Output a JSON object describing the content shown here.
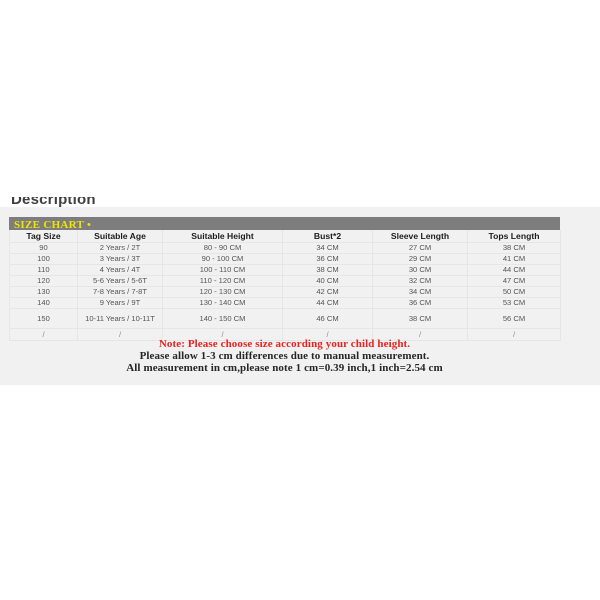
{
  "page": {
    "background_color": "#ffffff",
    "content_band_color": "#f1f1f1"
  },
  "description_heading": "Description",
  "size_chart": {
    "bar_label": "SIZE CHART •",
    "bar_color": "#7d7d7d",
    "title_color": "#f2e500",
    "columns": [
      "Tag Size",
      "Suitable Age",
      "Suitable Height",
      "Bust*2",
      "Sleeve Length",
      "Tops Length"
    ],
    "rows": [
      [
        "90",
        "2 Years / 2T",
        "80 - 90 CM",
        "34 CM",
        "27 CM",
        "38 CM"
      ],
      [
        "100",
        "3 Years / 3T",
        "90 - 100 CM",
        "36 CM",
        "29 CM",
        "41 CM"
      ],
      [
        "110",
        "4 Years / 4T",
        "100 - 110 CM",
        "38 CM",
        "30 CM",
        "44 CM"
      ],
      [
        "120",
        "5-6 Years / 5-6T",
        "110 - 120 CM",
        "40 CM",
        "32 CM",
        "47 CM"
      ],
      [
        "130",
        "7-8 Years / 7-8T",
        "120 - 130 CM",
        "42 CM",
        "34 CM",
        "50 CM"
      ],
      [
        "140",
        "9 Years / 9T",
        "130 - 140 CM",
        "44 CM",
        "36 CM",
        "53 CM"
      ],
      [
        "150",
        "10-11 Years / 10-11T",
        "140 - 150 CM",
        "46 CM",
        "38 CM",
        "56 CM"
      ],
      [
        "/",
        "/",
        "/",
        "/",
        "/",
        "/"
      ]
    ]
  },
  "notes": {
    "line1": "Note: Please choose size according your child height.",
    "line1_color": "#e8221f",
    "line2": "Please allow 1-3 cm differences due to manual measurement.",
    "line3": "All measurement in cm,please note 1 cm=0.39 inch,1 inch=2.54 cm",
    "text_color": "#262626"
  }
}
